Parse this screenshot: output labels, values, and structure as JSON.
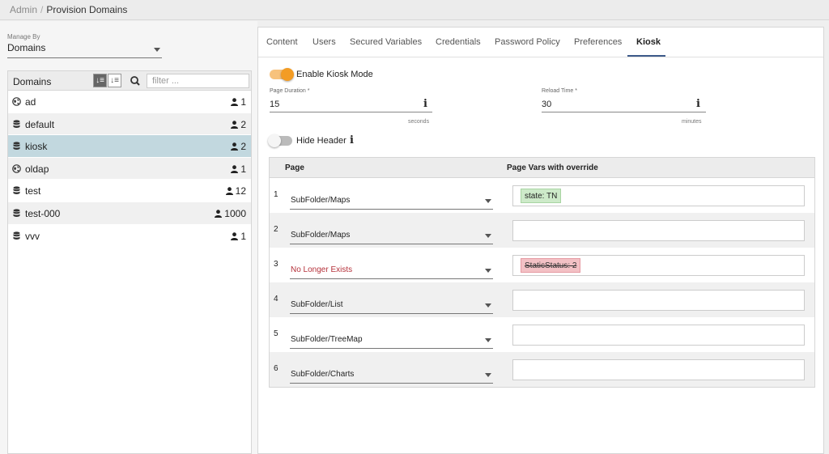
{
  "breadcrumb": {
    "parent": "Admin",
    "separator": "/",
    "current": "Provision Domains"
  },
  "sidebar": {
    "manage_by_label": "Manage By",
    "manage_by_value": "Domains",
    "panel_title": "Domains",
    "filter_placeholder": "filter ...",
    "items": [
      {
        "name": "ad",
        "count": "1",
        "icon": "globe-icon"
      },
      {
        "name": "default",
        "count": "2",
        "icon": "database-icon"
      },
      {
        "name": "kiosk",
        "count": "2",
        "icon": "database-icon"
      },
      {
        "name": "oldap",
        "count": "1",
        "icon": "globe-icon"
      },
      {
        "name": "test",
        "count": "12",
        "icon": "database-icon"
      },
      {
        "name": "test-000",
        "count": "1000",
        "icon": "database-icon"
      },
      {
        "name": "vvv",
        "count": "1",
        "icon": "database-icon"
      }
    ]
  },
  "tabs": [
    {
      "label": "Content"
    },
    {
      "label": "Users"
    },
    {
      "label": "Secured Variables"
    },
    {
      "label": "Credentials"
    },
    {
      "label": "Password Policy"
    },
    {
      "label": "Preferences"
    },
    {
      "label": "Kiosk"
    }
  ],
  "kiosk": {
    "enable_label": "Enable Kiosk Mode",
    "page_duration_label": "Page Duration *",
    "page_duration_value": "15",
    "page_duration_unit": "seconds",
    "reload_time_label": "Reload Time *",
    "reload_time_value": "30",
    "reload_time_unit": "minutes",
    "hide_header_label": "Hide Header",
    "info_glyph": "i",
    "col_page": "Page",
    "col_vars": "Page Vars with override",
    "rows": [
      {
        "num": "1",
        "page": "SubFolder/Maps",
        "chip": "state: TN"
      },
      {
        "num": "2",
        "page": "SubFolder/Maps",
        "chip": ""
      },
      {
        "num": "3",
        "page": "No Longer Exists",
        "chip": "StaticStatus: 2"
      },
      {
        "num": "4",
        "page": "SubFolder/List",
        "chip": ""
      },
      {
        "num": "5",
        "page": "SubFolder/TreeMap",
        "chip": ""
      },
      {
        "num": "6",
        "page": "SubFolder/Charts",
        "chip": ""
      }
    ]
  },
  "colors": {
    "accent": "#f39c24",
    "selected_row": "#c2d8df",
    "error_text": "#b5313a",
    "tab_underline": "#3d5a8a"
  }
}
